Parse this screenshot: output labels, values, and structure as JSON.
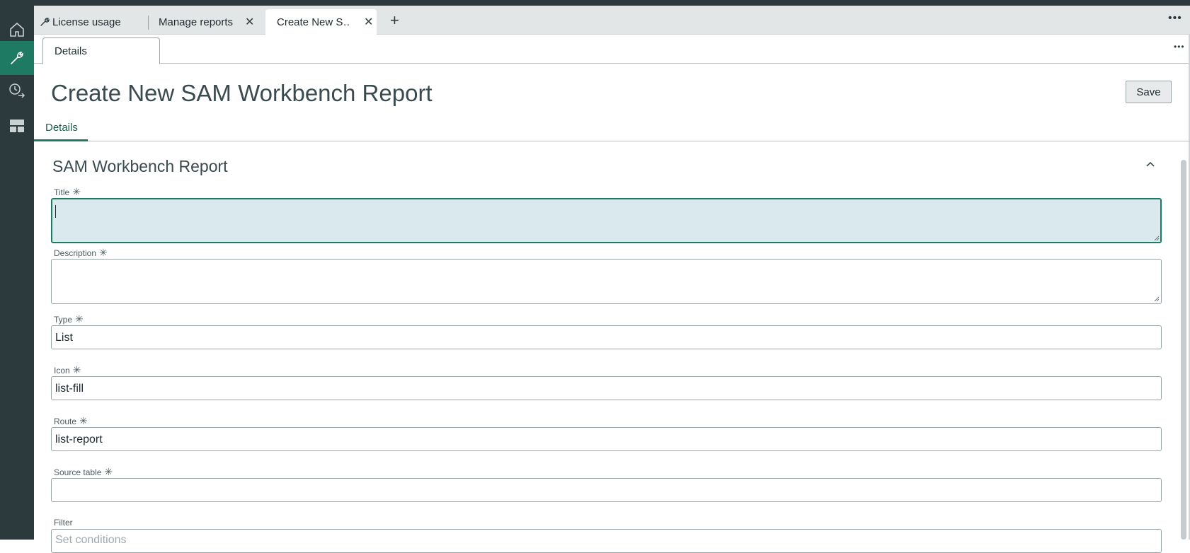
{
  "tabs": [
    {
      "label": "License usage"
    },
    {
      "label": "Manage reports"
    },
    {
      "label": "Create New S…"
    }
  ],
  "subtab": {
    "label": "Details"
  },
  "page": {
    "title": "Create New SAM Workbench Report",
    "save_label": "Save"
  },
  "form_tabs": [
    {
      "label": "Details"
    }
  ],
  "section": {
    "title": "SAM Workbench Report"
  },
  "fields": {
    "title": {
      "label": "Title",
      "value": ""
    },
    "description": {
      "label": "Description",
      "value": ""
    },
    "type": {
      "label": "Type",
      "value": "List"
    },
    "icon": {
      "label": "Icon",
      "value": "list-fill"
    },
    "route": {
      "label": "Route",
      "value": "list-report"
    },
    "source_table": {
      "label": "Source table",
      "value": ""
    },
    "filter": {
      "label": "Filter",
      "placeholder": "Set conditions"
    }
  },
  "required_marker": "✳",
  "colors": {
    "rail": "#2c3a3d",
    "accent": "#1e7a62",
    "focus_fill": "#d9e9ee"
  }
}
